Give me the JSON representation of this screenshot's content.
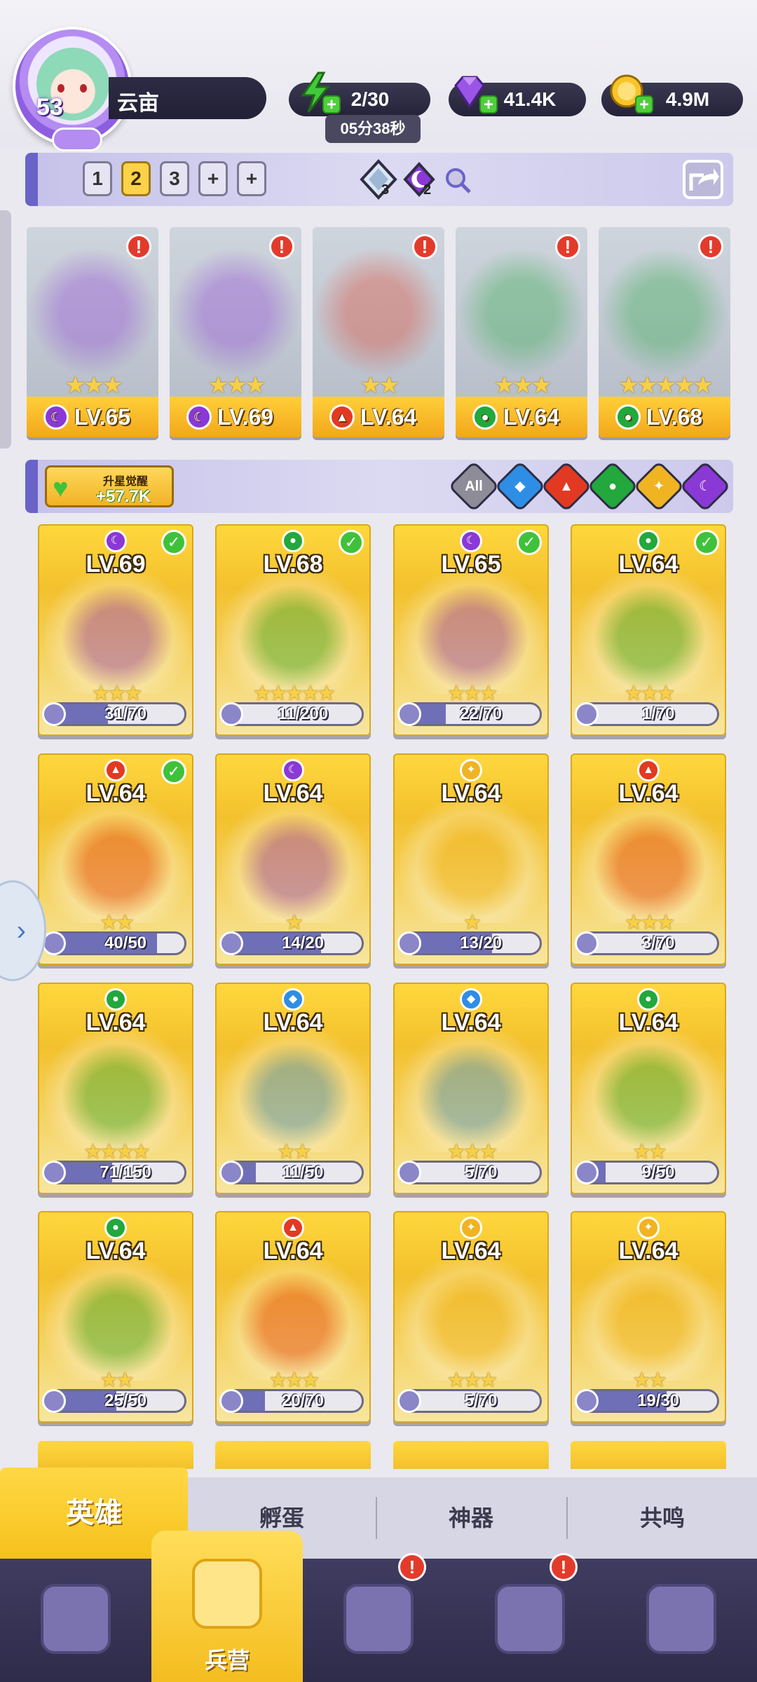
{
  "player": {
    "level": "53",
    "name": "云亩"
  },
  "resources": {
    "energy": "2/30",
    "energy_timer": "05分38秒",
    "gems": "41.4K",
    "coins": "4.9M"
  },
  "team_bar": {
    "tabs": [
      "1",
      "2",
      "3",
      "+",
      "+"
    ],
    "active_tab": "2",
    "gem_slots": [
      {
        "icon": "diamond-gem-icon",
        "count": "3"
      },
      {
        "icon": "dark-gem-icon",
        "count": "2"
      }
    ]
  },
  "team": [
    {
      "level": "LV.65",
      "element": "dark",
      "stars": "★★★"
    },
    {
      "level": "LV.69",
      "element": "dark",
      "stars": "★★★"
    },
    {
      "level": "LV.64",
      "element": "fire",
      "stars": "★★"
    },
    {
      "level": "LV.64",
      "element": "nature",
      "stars": "★★★"
    },
    {
      "level": "LV.68",
      "element": "nature",
      "stars": "★★★★★"
    }
  ],
  "filter_bar": {
    "awaken_title": "升星觉醒",
    "awaken_value": "+57.7K",
    "filters": [
      {
        "id": "all",
        "label": "All",
        "color": "#8e8c98"
      },
      {
        "id": "water",
        "label": "",
        "color": "#2e8ee6"
      },
      {
        "id": "fire",
        "label": "",
        "color": "#e23a22"
      },
      {
        "id": "nature",
        "label": "",
        "color": "#22a83c"
      },
      {
        "id": "light",
        "label": "",
        "color": "#f0b322"
      },
      {
        "id": "dark",
        "label": "",
        "color": "#8a38d6"
      }
    ]
  },
  "heroes": [
    {
      "level": "LV.69",
      "element": "dark",
      "checked": true,
      "shards": "31/70",
      "fill": 0.44,
      "stars": "★★★"
    },
    {
      "level": "LV.68",
      "element": "nature",
      "checked": true,
      "shards": "11/200",
      "fill": 0.06,
      "stars": "★★★★★"
    },
    {
      "level": "LV.65",
      "element": "dark",
      "checked": true,
      "shards": "22/70",
      "fill": 0.31,
      "stars": "★★★"
    },
    {
      "level": "LV.64",
      "element": "nature",
      "checked": true,
      "shards": "1/70",
      "fill": 0.01,
      "stars": "★★★"
    },
    {
      "level": "LV.64",
      "element": "fire",
      "checked": true,
      "shards": "40/50",
      "fill": 0.8,
      "stars": "★★"
    },
    {
      "level": "LV.64",
      "element": "dark",
      "checked": false,
      "shards": "14/20",
      "fill": 0.7,
      "stars": "★"
    },
    {
      "level": "LV.64",
      "element": "light",
      "checked": false,
      "shards": "13/20",
      "fill": 0.65,
      "stars": "★"
    },
    {
      "level": "LV.64",
      "element": "fire",
      "checked": false,
      "shards": "3/70",
      "fill": 0.04,
      "stars": "★★★"
    },
    {
      "level": "LV.64",
      "element": "nature",
      "checked": false,
      "shards": "71/150",
      "fill": 0.47,
      "stars": "★★★★"
    },
    {
      "level": "LV.64",
      "element": "water",
      "checked": false,
      "shards": "11/50",
      "fill": 0.22,
      "stars": "★★"
    },
    {
      "level": "LV.64",
      "element": "water",
      "checked": false,
      "shards": "5/70",
      "fill": 0.07,
      "stars": "★★★"
    },
    {
      "level": "LV.64",
      "element": "nature",
      "checked": false,
      "shards": "9/50",
      "fill": 0.18,
      "stars": "★★"
    },
    {
      "level": "LV.64",
      "element": "nature",
      "checked": false,
      "shards": "25/50",
      "fill": 0.5,
      "stars": "★★"
    },
    {
      "level": "LV.64",
      "element": "fire",
      "checked": false,
      "shards": "20/70",
      "fill": 0.29,
      "stars": "★★★"
    },
    {
      "level": "LV.64",
      "element": "light",
      "checked": false,
      "shards": "5/70",
      "fill": 0.07,
      "stars": "★★★"
    },
    {
      "level": "LV.64",
      "element": "light",
      "checked": false,
      "shards": "19/30",
      "fill": 0.63,
      "stars": "★★"
    }
  ],
  "subtabs": [
    "英雄",
    "孵蛋",
    "神器",
    "共鸣"
  ],
  "nav": {
    "active_label": "兵营",
    "items": [
      {
        "icon": "cards-icon",
        "alert": false
      },
      {
        "icon": "barracks-icon",
        "alert": false
      },
      {
        "icon": "map-icon",
        "alert": true
      },
      {
        "icon": "temple-icon",
        "alert": true
      },
      {
        "icon": "mushroom-icon",
        "alert": false
      }
    ]
  },
  "colors": {
    "water": "#2e8ee6",
    "fire": "#e23a22",
    "nature": "#22a83c",
    "light": "#f0b322",
    "dark": "#8a38d6",
    "accent": "#f6c21c"
  }
}
